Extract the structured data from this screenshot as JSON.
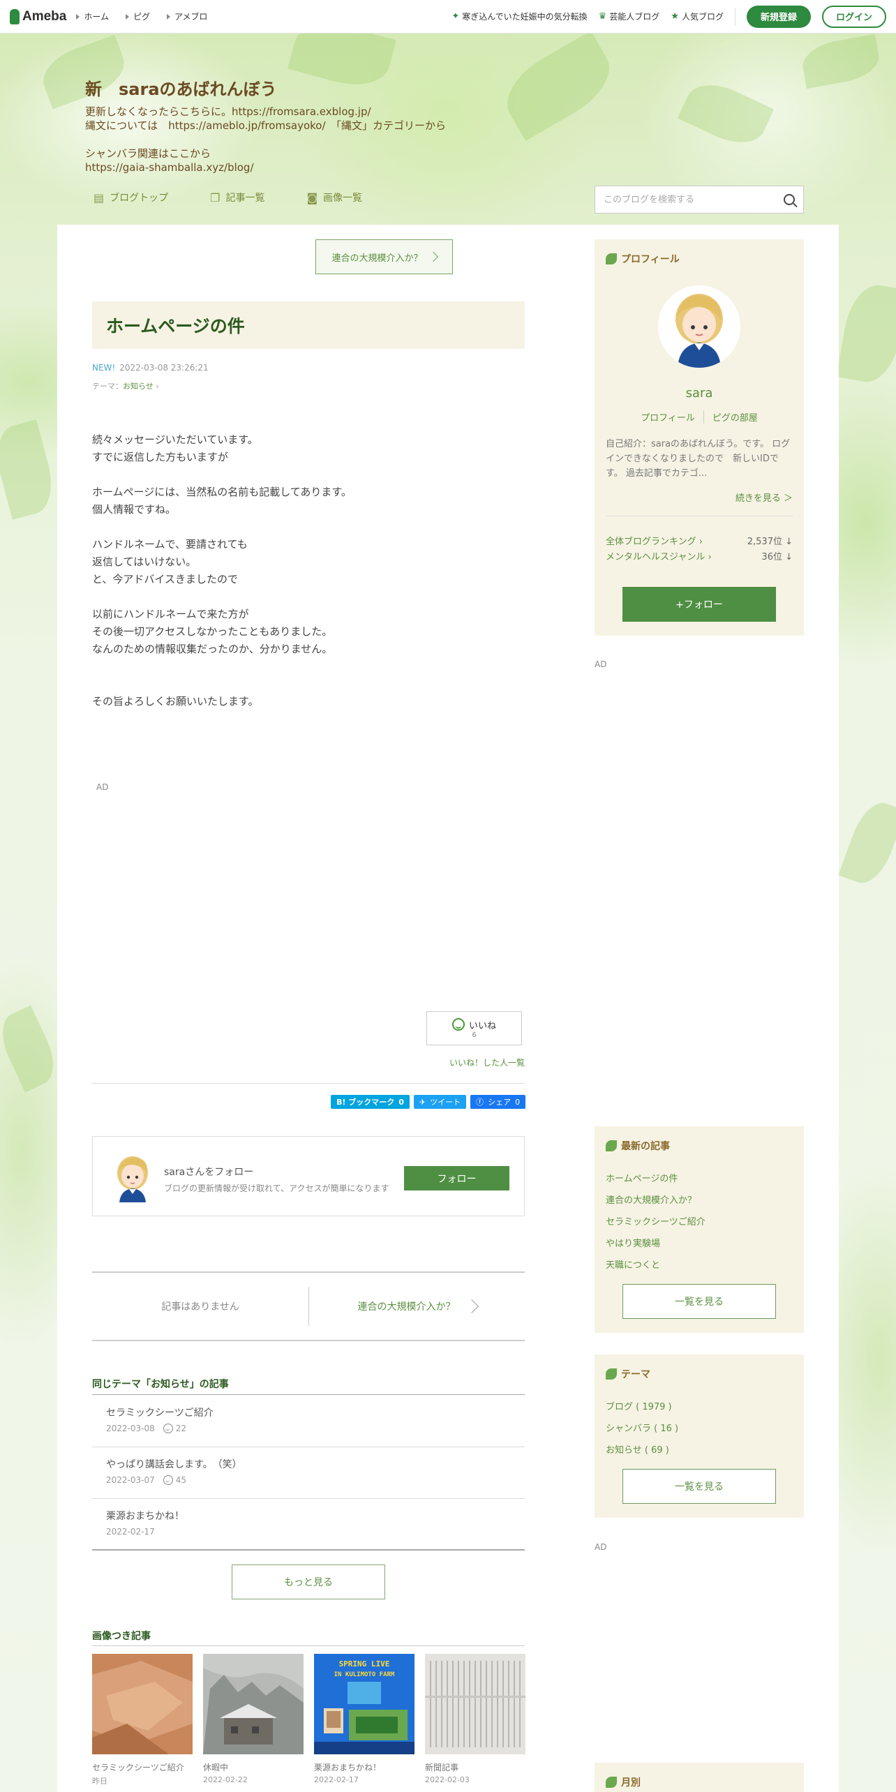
{
  "topbar": {
    "logo": "Ameba",
    "nav": [
      "ホーム",
      "ピグ",
      "アメブロ"
    ],
    "right_links": [
      {
        "icon": "sparkle-icon",
        "label": "寒ぎ込んでいた妊娠中の気分転換"
      },
      {
        "icon": "crown-icon",
        "label": "芸能人ブログ"
      },
      {
        "icon": "star-icon",
        "label": "人気ブログ"
      }
    ],
    "register": "新規登録",
    "login": "ログイン"
  },
  "blog": {
    "title": "新　saraのあばれんぼう",
    "description": [
      "更新しなくなったらこちらに。https://fromsara.exblog.jp/",
      "縄文については　https://ameblo.jp/fromsayoko/　「縄文」カテゴリーから",
      "",
      "シャンバラ関連はここから",
      "https://gaia-shamballa.xyz/blog/"
    ],
    "subnav": [
      {
        "icon": "document-icon",
        "label": "ブログトップ"
      },
      {
        "icon": "copy-icon",
        "label": "記事一覧"
      },
      {
        "icon": "camera-icon",
        "label": "画像一覧"
      }
    ],
    "search_placeholder": "このブログを検索する"
  },
  "entry": {
    "prev_link": "連合の大規模介入か？",
    "title": "ホームページの件",
    "new_label": "NEW!",
    "datetime": "2022-03-08 23:26:21",
    "theme_label": "テーマ：",
    "theme": "お知らせ",
    "body": [
      "続々メッセージいただいています。",
      "すでに返信した方もいますが",
      "",
      "ホームページには、当然私の名前も記載してあります。",
      "個人情報ですね。",
      "",
      "ハンドルネームで、要請されても",
      "返信してはいけない。",
      "と、今アドバイスきましたので",
      "",
      "以前にハンドルネームで来た方が",
      "その後一切アクセスしなかったこともありました。",
      "なんのための情報収集だったのか、分かりません。",
      "",
      "",
      "その旨よろしくお願いいたします。"
    ],
    "ad": "AD",
    "iine_label": "いいね",
    "iine_count": "6",
    "iine_list": "いいね！した人一覧",
    "share": {
      "hatena": "B! ブックマーク",
      "hatena_count": "0",
      "tweet": "ツイート",
      "facebook": "シェア",
      "facebook_count": "0"
    },
    "follow_box": {
      "name": "saraさんをフォロー",
      "sub": "ブログの更新情報が受け取れて、アクセスが簡単になります",
      "button": "フォロー"
    },
    "pager": {
      "prev": "記事はありません",
      "next": "連合の大規模介入か？"
    }
  },
  "related": {
    "heading": "同じテーマ「お知らせ」の記事",
    "items": [
      {
        "title": "セラミックシーツご紹介",
        "date": "2022-03-08",
        "likes": "22"
      },
      {
        "title": "やっぱり講話会します。　（笑）",
        "date": "2022-03-07",
        "likes": "45"
      },
      {
        "title": "栗源おまちかね！",
        "date": "2022-02-17",
        "likes": ""
      }
    ],
    "more": "もっと見る"
  },
  "image_posts": {
    "heading": "画像つき記事",
    "items": [
      {
        "caption": "セラミックシーツご紹介",
        "date": "昨日"
      },
      {
        "caption": "休暇中",
        "date": "2022-02-22"
      },
      {
        "caption": "栗源おまちかね！",
        "date": "2022-02-17",
        "poster_text": "SPRING LIVE IN KULIMOTO FARM"
      },
      {
        "caption": "新聞記事",
        "date": "2022-02-03"
      }
    ]
  },
  "sidebar": {
    "profile": {
      "heading": "プロフィール",
      "name": "sara",
      "link1": "プロフィール",
      "link2": "ピグの部屋",
      "desc": "自己紹介：saraのあばれんぼう。です。 ログインできなくなりましたので　新しいIDです。 過去記事でカテゴ...",
      "more": "続きを見る ＞",
      "ranks": [
        {
          "label": "全体ブログランキング",
          "value": "2,537位 ↓"
        },
        {
          "label": "メンタルヘルスジャンル",
          "value": "36位 ↓"
        }
      ],
      "follow": "+フォロー"
    },
    "ad": "AD",
    "latest": {
      "heading": "最新の記事",
      "items": [
        "ホームページの件",
        "連合の大規模介入か？",
        "セラミックシーツご紹介",
        "やはり実験場",
        "天職につくと"
      ],
      "all": "一覧を見る"
    },
    "themes": {
      "heading": "テーマ",
      "items": [
        "ブログ ( 1979 )",
        "シャンバラ ( 16 )",
        "お知らせ ( 69 )"
      ],
      "all": "一覧を見る"
    },
    "ad2": "AD",
    "monthly": {
      "heading": "月別"
    }
  },
  "colors": {
    "accent_green": "#2d8a3e",
    "link_green": "#5b8f3f",
    "title_brown": "#6b4a22",
    "sidebar_bg": "#f6f3e4"
  }
}
